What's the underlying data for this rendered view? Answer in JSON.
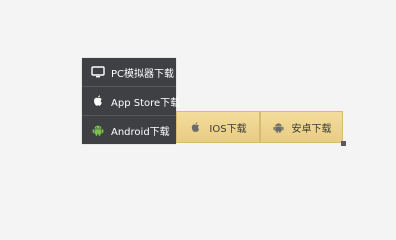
{
  "menu": {
    "items": [
      {
        "label": "PC模拟器下载",
        "icon": "monitor-icon"
      },
      {
        "label": "App Store下载",
        "icon": "apple-icon"
      },
      {
        "label": "Android下载",
        "icon": "android-icon"
      }
    ]
  },
  "buttons": {
    "ios_label": "IOS下载",
    "android_label": "安卓下载"
  },
  "colors": {
    "menu_bg": "#3f4044",
    "gold": "#eed38e",
    "android_green": "#79c14a"
  }
}
